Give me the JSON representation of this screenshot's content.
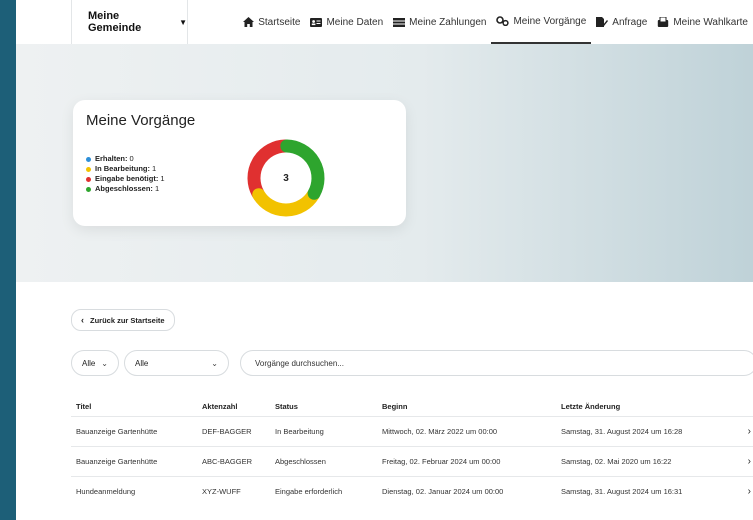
{
  "header": {
    "gemeinde": "Meine Gemeinde",
    "nav": [
      {
        "label": "Startseite",
        "icon": "home-icon"
      },
      {
        "label": "Meine Daten",
        "icon": "id-card-icon"
      },
      {
        "label": "Meine Zahlungen",
        "icon": "wallet-icon"
      },
      {
        "label": "Meine Vorgänge",
        "icon": "gears-icon",
        "active": true
      },
      {
        "label": "Anfrage",
        "icon": "file-pen-icon"
      },
      {
        "label": "Meine Wahlkarte",
        "icon": "ballot-icon"
      }
    ]
  },
  "summary": {
    "title": "Meine Vorgänge",
    "total": "3",
    "legend": [
      {
        "label": "Erhalten:",
        "value": "0",
        "color": "#2d8fd8"
      },
      {
        "label": "In Bearbeitung:",
        "value": "1",
        "color": "#f2c200"
      },
      {
        "label": "Eingabe benötigt:",
        "value": "1",
        "color": "#e03030"
      },
      {
        "label": "Abgeschlossen:",
        "value": "1",
        "color": "#2ea52e"
      }
    ]
  },
  "chart_data": {
    "type": "pie",
    "categories": [
      "Erhalten",
      "In Bearbeitung",
      "Eingabe benötigt",
      "Abgeschlossen"
    ],
    "values": [
      0,
      1,
      1,
      1
    ],
    "colors": [
      "#2d8fd8",
      "#f2c200",
      "#e03030",
      "#2ea52e"
    ],
    "center_label": "3"
  },
  "controls": {
    "back_label": "Zurück zur Startseite",
    "filter1": "Alle",
    "filter2": "Alle",
    "search_placeholder": "Vorgänge durchsuchen..."
  },
  "table": {
    "columns": [
      "Titel",
      "Aktenzahl",
      "Status",
      "Beginn",
      "Letzte Änderung"
    ],
    "rows": [
      [
        "Bauanzeige Gartenhütte",
        "DEF-BAGGER",
        "In Bearbeitung",
        "Mittwoch, 02. März 2022 um 00:00",
        "Samstag, 31. August 2024 um 16:28"
      ],
      [
        "Bauanzeige Gartenhütte",
        "ABC-BAGGER",
        "Abgeschlossen",
        "Freitag, 02. Februar 2024 um 00:00",
        "Samstag, 02. Mai 2020 um 16:22"
      ],
      [
        "Hundeanmeldung",
        "XYZ-WUFF",
        "Eingabe erforderlich",
        "Dienstag, 02. Januar 2024 um 00:00",
        "Samstag, 31. August 2024 um 16:31"
      ]
    ]
  }
}
